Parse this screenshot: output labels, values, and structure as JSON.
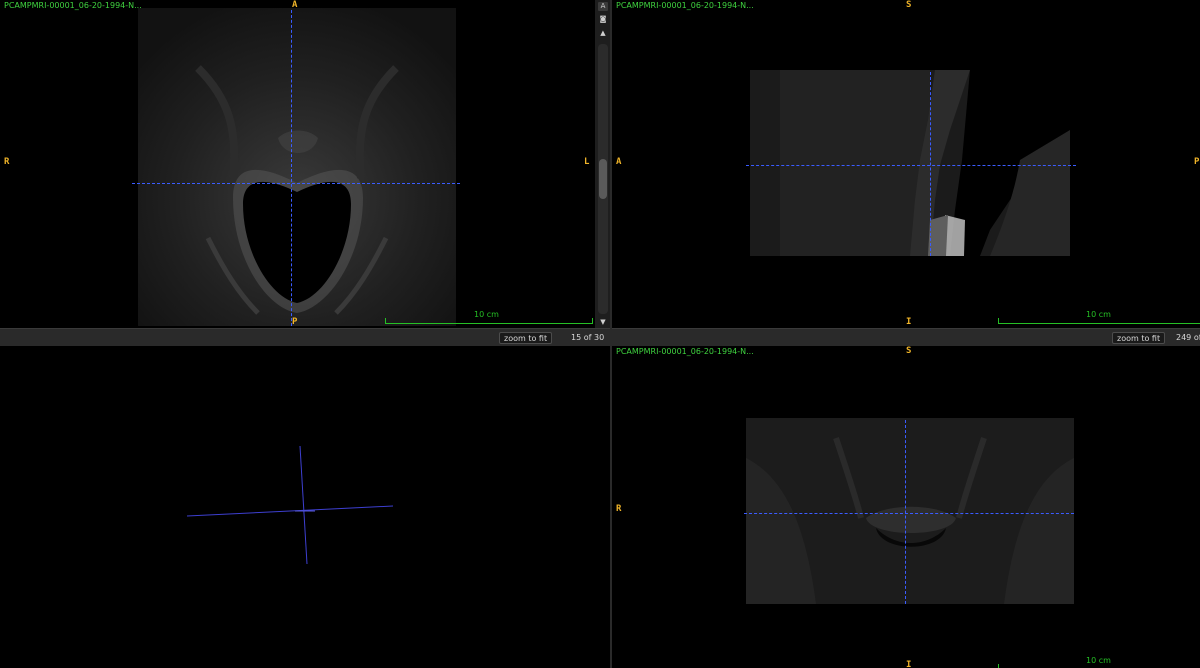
{
  "viewer": {
    "accent_text_color": "#3fd23f",
    "orientation_color": "#f0b429",
    "crosshair_color": "#3b5cff",
    "scalebar_color": "#25c025"
  },
  "axial": {
    "title": "PCAMPMRI-00001_06-20-1994-N...",
    "orient": {
      "top": "A",
      "bottom": "P",
      "left": "R",
      "right": "L"
    },
    "scale_label": "10 cm",
    "zoom_label": "zoom to fit",
    "slice_text": "15 of 30",
    "slice_fraction": 0.5
  },
  "sagittal": {
    "title": "PCAMPMRI-00001_06-20-1994-N...",
    "orient": {
      "top": "S",
      "bottom": "I",
      "left": "A",
      "right": "P"
    },
    "scale_label": "10 cm",
    "zoom_label": "zoom to fit",
    "slice_text": "249 of"
  },
  "coronal": {
    "title": "PCAMPMRI-00001_06-20-1994-N...",
    "orient": {
      "top": "S",
      "bottom": "I",
      "left": "R"
    },
    "scale_label": "10 cm"
  },
  "strip": {
    "icons": [
      "text-icon",
      "camera-icon"
    ],
    "text_icon_glyph": "A",
    "camera_icon_glyph": "◙",
    "up_glyph": "▲",
    "down_glyph": "▼"
  }
}
